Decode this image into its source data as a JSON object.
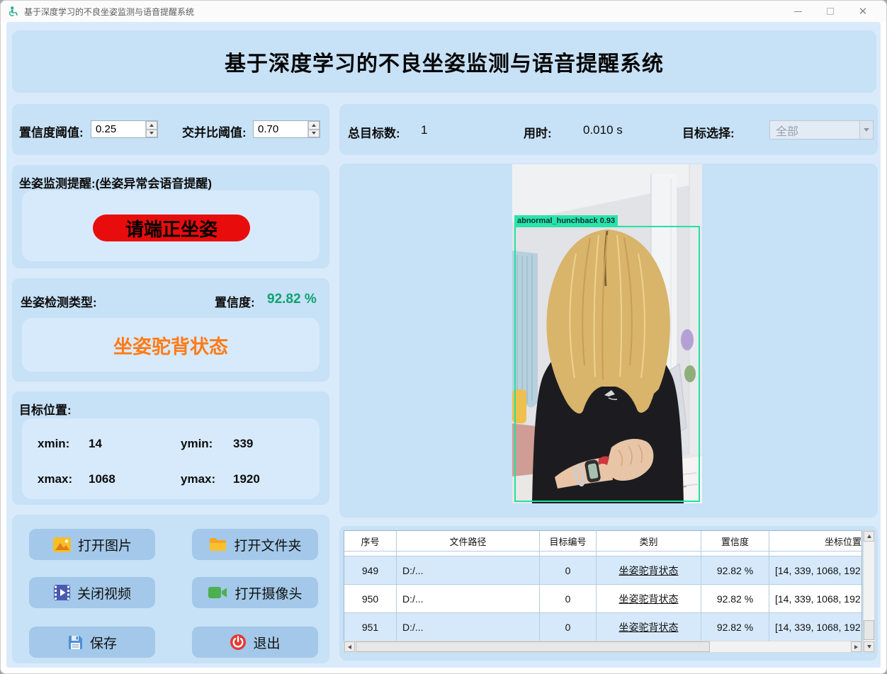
{
  "window": {
    "title": "基于深度学习的不良坐姿监测与语音提醒系统"
  },
  "header": {
    "title": "基于深度学习的不良坐姿监测与语音提醒系统"
  },
  "thresholds": {
    "conf_label": "置信度阈值:",
    "conf_value": "0.25",
    "iou_label": "交并比阈值:",
    "iou_value": "0.70"
  },
  "stats": {
    "total_label": "总目标数:",
    "total_value": "1",
    "time_label": "用时:",
    "time_value": "0.010 s",
    "target_label": "目标选择:",
    "target_selected": "全部"
  },
  "reminder": {
    "label": "坐姿监测提醒:(坐姿异常会语音提醒)",
    "alert_text": "请端正坐姿"
  },
  "detection": {
    "type_label": "坐姿检测类型:",
    "conf_label": "置信度:",
    "conf_value": "92.82 %",
    "state_text": "坐姿驼背状态"
  },
  "position": {
    "label": "目标位置:",
    "xmin_label": "xmin:",
    "xmin_value": "14",
    "ymin_label": "ymin:",
    "ymin_value": "339",
    "xmax_label": "xmax:",
    "xmax_value": "1068",
    "ymax_label": "ymax:",
    "ymax_value": "1920"
  },
  "buttons": {
    "open_image": "打开图片",
    "open_folder": "打开文件夹",
    "close_video": "关闭视频",
    "open_camera": "打开摄像头",
    "save": "保存",
    "exit": "退出"
  },
  "viewer": {
    "detection_label": "abnormal_hunchback 0.93"
  },
  "table": {
    "headers": [
      "序号",
      "文件路径",
      "目标编号",
      "类别",
      "置信度",
      "坐标位置"
    ],
    "rows": [
      {
        "index": "949",
        "path": "D:/...",
        "target_id": "0",
        "category": "坐姿驼背状态",
        "confidence": "92.82 %",
        "coords": "[14, 339, 1068, 192"
      },
      {
        "index": "950",
        "path": "D:/...",
        "target_id": "0",
        "category": "坐姿驼背状态",
        "confidence": "92.82 %",
        "coords": "[14, 339, 1068, 192"
      },
      {
        "index": "951",
        "path": "D:/...",
        "target_id": "0",
        "category": "坐姿驼背状态",
        "confidence": "92.82 %",
        "coords": "[14, 339, 1068, 192"
      }
    ]
  },
  "colors": {
    "alert_red": "#e90c0c",
    "state_orange": "#ff7b17",
    "confidence_green": "#0ca271",
    "detection_teal": "#1fe3a6",
    "panel_blue": "#c7e1f6"
  }
}
